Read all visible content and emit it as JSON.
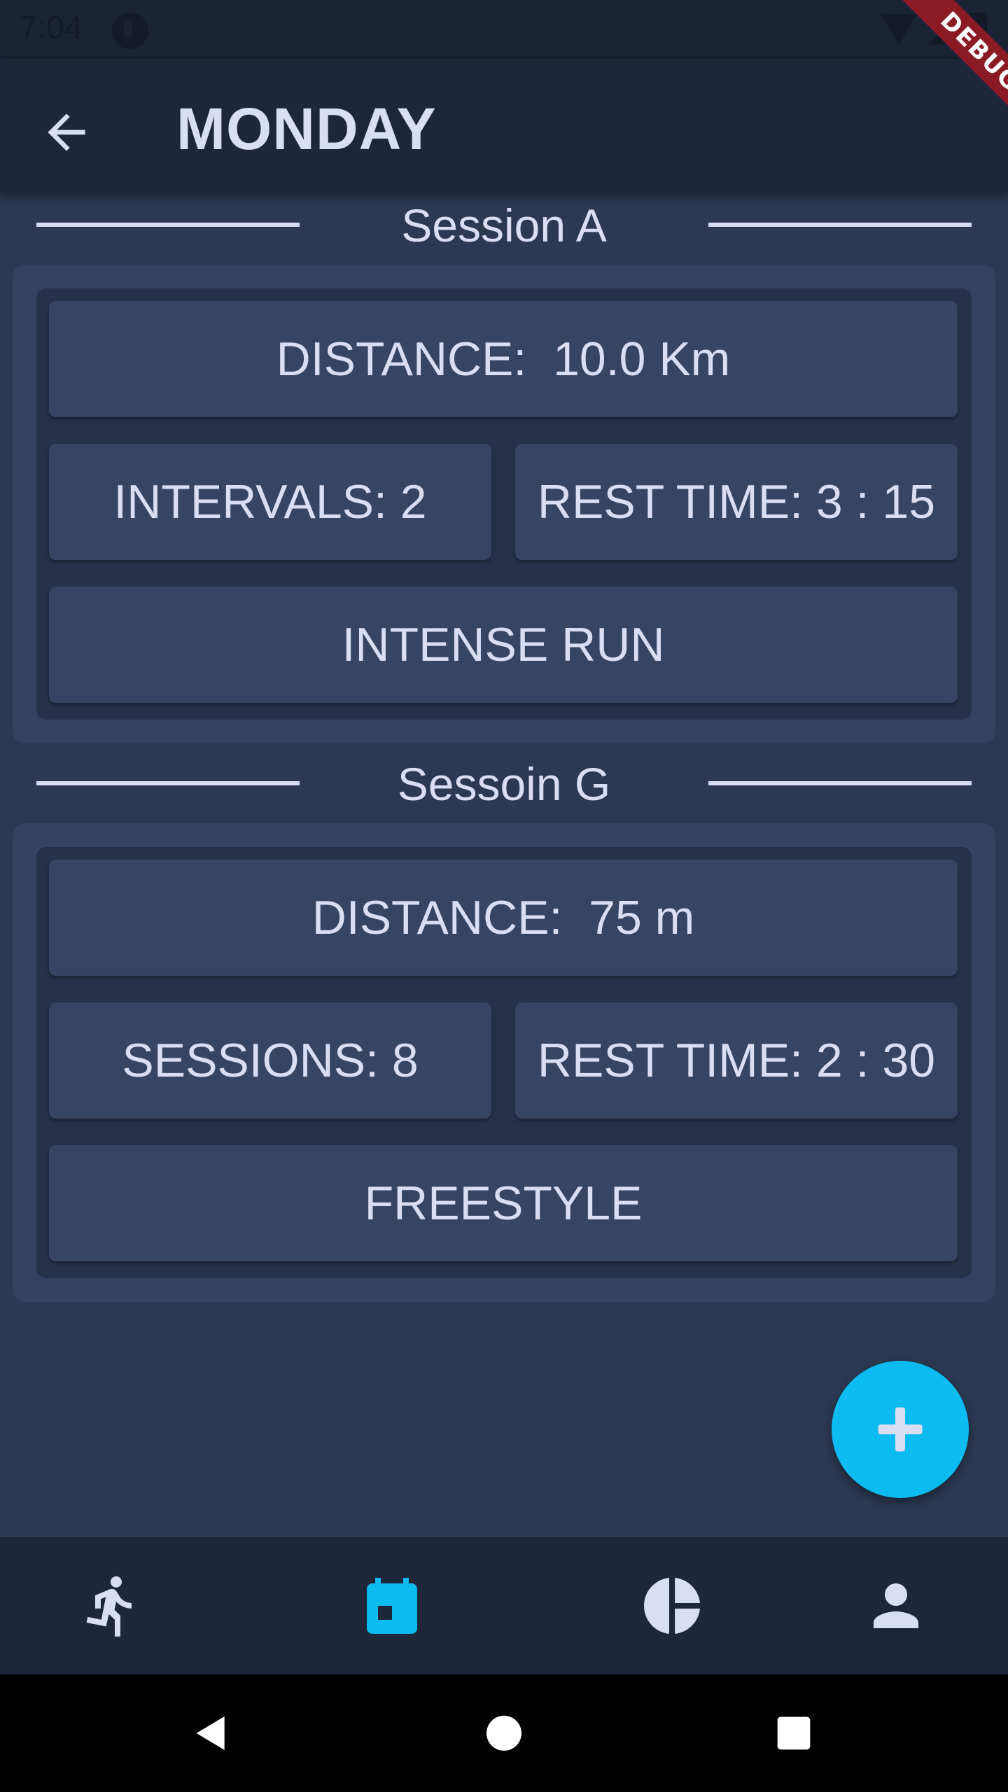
{
  "status_bar": {
    "time": "7:04",
    "debug_label": "DEBUG"
  },
  "app_bar": {
    "title": "MONDAY",
    "back_icon": "arrow-back-icon"
  },
  "sessions": [
    {
      "title": "Session A",
      "distance": "DISTANCE:  10.0 Km",
      "count": "INTERVALS: 2",
      "rest_time": "REST TIME: 3 : 15",
      "type": "INTENSE RUN"
    },
    {
      "title": "Sessoin G",
      "distance": "DISTANCE:  75 m",
      "count": "SESSIONS: 8",
      "rest_time": "REST TIME: 2 : 30",
      "type": "FREESTYLE"
    }
  ],
  "fab": {
    "icon": "plus-icon"
  },
  "bottom_nav": {
    "items": [
      {
        "icon": "running-icon",
        "active": false
      },
      {
        "icon": "calendar-icon",
        "active": true
      },
      {
        "icon": "pie-chart-icon",
        "active": false
      },
      {
        "icon": "person-icon",
        "active": false
      }
    ]
  },
  "colors": {
    "background": "#2b3952",
    "app_bar": "#1e2639",
    "accent": "#0cbbf0",
    "text": "#d9def3",
    "debug_banner": "#8a1b25"
  }
}
